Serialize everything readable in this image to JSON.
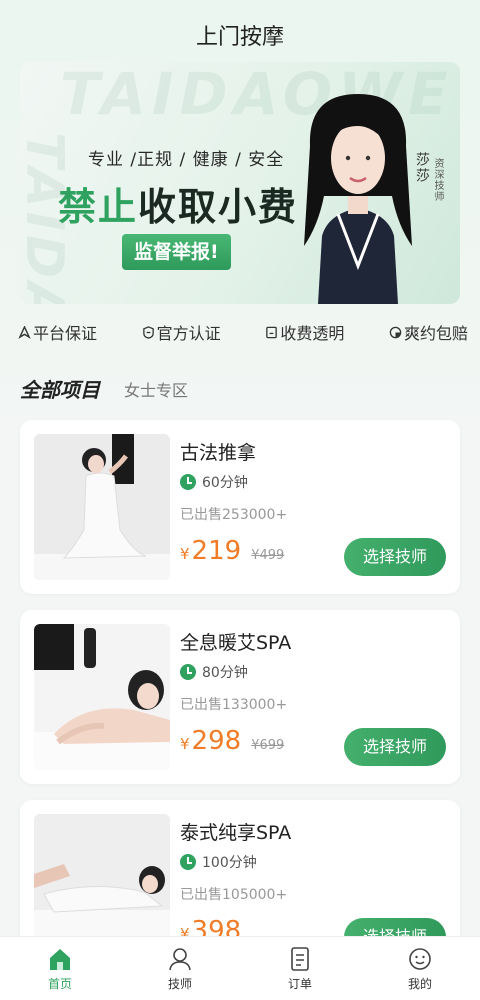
{
  "header": {
    "title": "上门按摩"
  },
  "banner": {
    "slogan": "专业 /正规 / 健康 / 安全",
    "headline_green": "禁止",
    "headline_dark": "收取小费",
    "report_button": "监督举报!",
    "person_name": "莎莎",
    "person_role": "资深技师"
  },
  "guarantees": [
    {
      "label": "平台保证",
      "icon": "shield-check-icon"
    },
    {
      "label": "官方认证",
      "icon": "badge-icon"
    },
    {
      "label": "收费透明",
      "icon": "receipt-icon"
    },
    {
      "label": "爽约包赔",
      "icon": "compensation-icon"
    }
  ],
  "tabs": {
    "active": "全部项目",
    "other": "女士专区"
  },
  "services": [
    {
      "name": "古法推拿",
      "duration": "60分钟",
      "sold": "已出售253000+",
      "currency": "¥",
      "price": "219",
      "old_price": "¥499",
      "button": "选择技师"
    },
    {
      "name": "全息暖艾SPA",
      "duration": "80分钟",
      "sold": "已出售133000+",
      "currency": "¥",
      "price": "298",
      "old_price": "¥699",
      "button": "选择技师"
    },
    {
      "name": "泰式纯享SPA",
      "duration": "100分钟",
      "sold": "已出售105000+",
      "currency": "¥",
      "price": "398",
      "old_price": "",
      "button": "选择技师"
    }
  ],
  "nav": [
    {
      "label": "首页",
      "icon": "home-icon"
    },
    {
      "label": "技师",
      "icon": "therapist-icon"
    },
    {
      "label": "订单",
      "icon": "order-icon"
    },
    {
      "label": "我的",
      "icon": "profile-icon"
    }
  ],
  "colors": {
    "accent": "#2ea25e",
    "price": "#f07c28"
  }
}
